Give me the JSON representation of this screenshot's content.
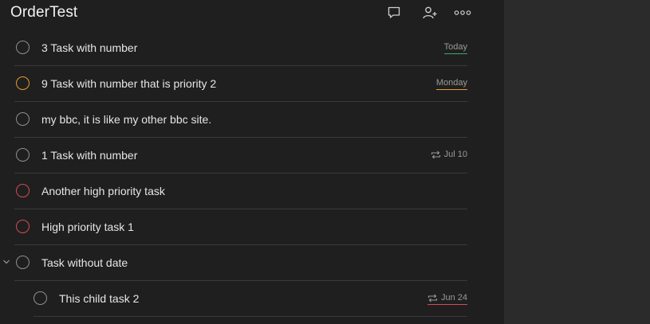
{
  "header": {
    "title": "OrderTest",
    "icons": [
      "comment-icon",
      "add-person-icon",
      "more-icon"
    ]
  },
  "tasks": [
    {
      "title": "3 Task with number",
      "due": "Today",
      "priority": "none",
      "repeat": false,
      "underline": "#3aa86a",
      "child": false,
      "expandable": false
    },
    {
      "title": "9 Task with number that is priority 2",
      "due": "Monday",
      "priority": "medium",
      "repeat": false,
      "underline": "#e39b2d",
      "child": false,
      "expandable": false
    },
    {
      "title": "my bbc, it is like my other bbc site.",
      "due": "",
      "priority": "none",
      "repeat": false,
      "underline": "",
      "child": false,
      "expandable": false
    },
    {
      "title": "1 Task with number",
      "due": "Jul 10",
      "priority": "none",
      "repeat": true,
      "underline": "",
      "child": false,
      "expandable": false
    },
    {
      "title": "Another high priority task",
      "due": "",
      "priority": "high",
      "repeat": false,
      "underline": "",
      "child": false,
      "expandable": false
    },
    {
      "title": "High priority task 1",
      "due": "",
      "priority": "high",
      "repeat": false,
      "underline": "",
      "child": false,
      "expandable": false
    },
    {
      "title": "Task without date",
      "due": "",
      "priority": "none",
      "repeat": false,
      "underline": "",
      "child": false,
      "expandable": true
    },
    {
      "title": "This child task 2",
      "due": "Jun 24",
      "priority": "none",
      "repeat": true,
      "underline": "#d44b53",
      "child": true,
      "expandable": false
    }
  ],
  "colors": {
    "background": "#1f1f1f",
    "side_panel": "#2b2b2b",
    "priority_medium": "#e39b2d",
    "priority_high": "#d44b53",
    "today": "#3aa86a"
  }
}
